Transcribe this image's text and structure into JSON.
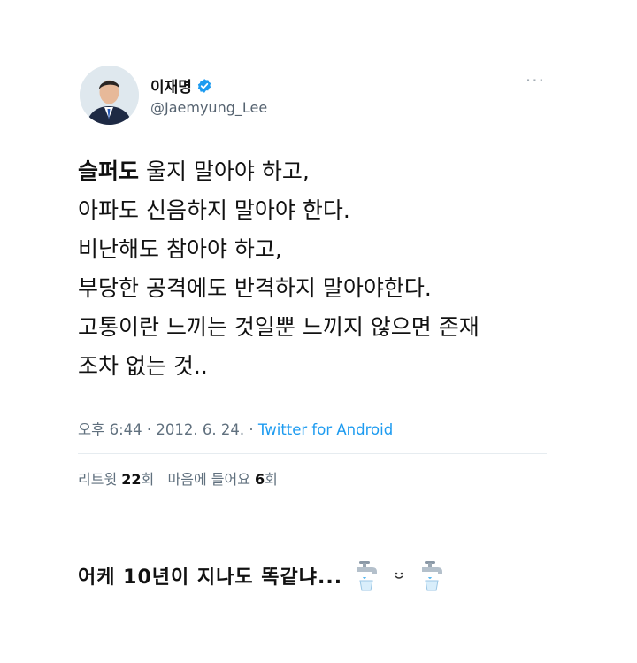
{
  "tweet": {
    "display_name": "이재명",
    "handle": "@Jaemyung_Lee",
    "more_label": "···",
    "first_line_bold": "슬퍼도",
    "first_line_rest": " 울지 말아야 하고,",
    "lines": [
      "아파도 신음하지 말아야 한다.",
      "비난해도 참아야 하고,",
      "부당한 공격에도 반격하지 말아야한다.",
      "고통이란 느끼는 것일뿐 느끼지 않으면 존재",
      "조차 없는 것.."
    ],
    "time": "오후 6:44",
    "date": "2012. 6. 24.",
    "source": "Twitter for Android",
    "retweets_label": "리트윗",
    "retweets_count": "22",
    "retweets_unit": "회",
    "likes_label": "마음에 들어요",
    "likes_count": "6",
    "likes_unit": "회"
  },
  "caption": {
    "text": "어케 10년이 지나도 똑같냐...",
    "emojis": [
      "faucet-icon",
      "smiling-face-icon",
      "faucet-icon"
    ]
  },
  "colors": {
    "link": "#1d9bf0",
    "secondary_text": "#60707e",
    "verified": "#1d9bf0"
  }
}
